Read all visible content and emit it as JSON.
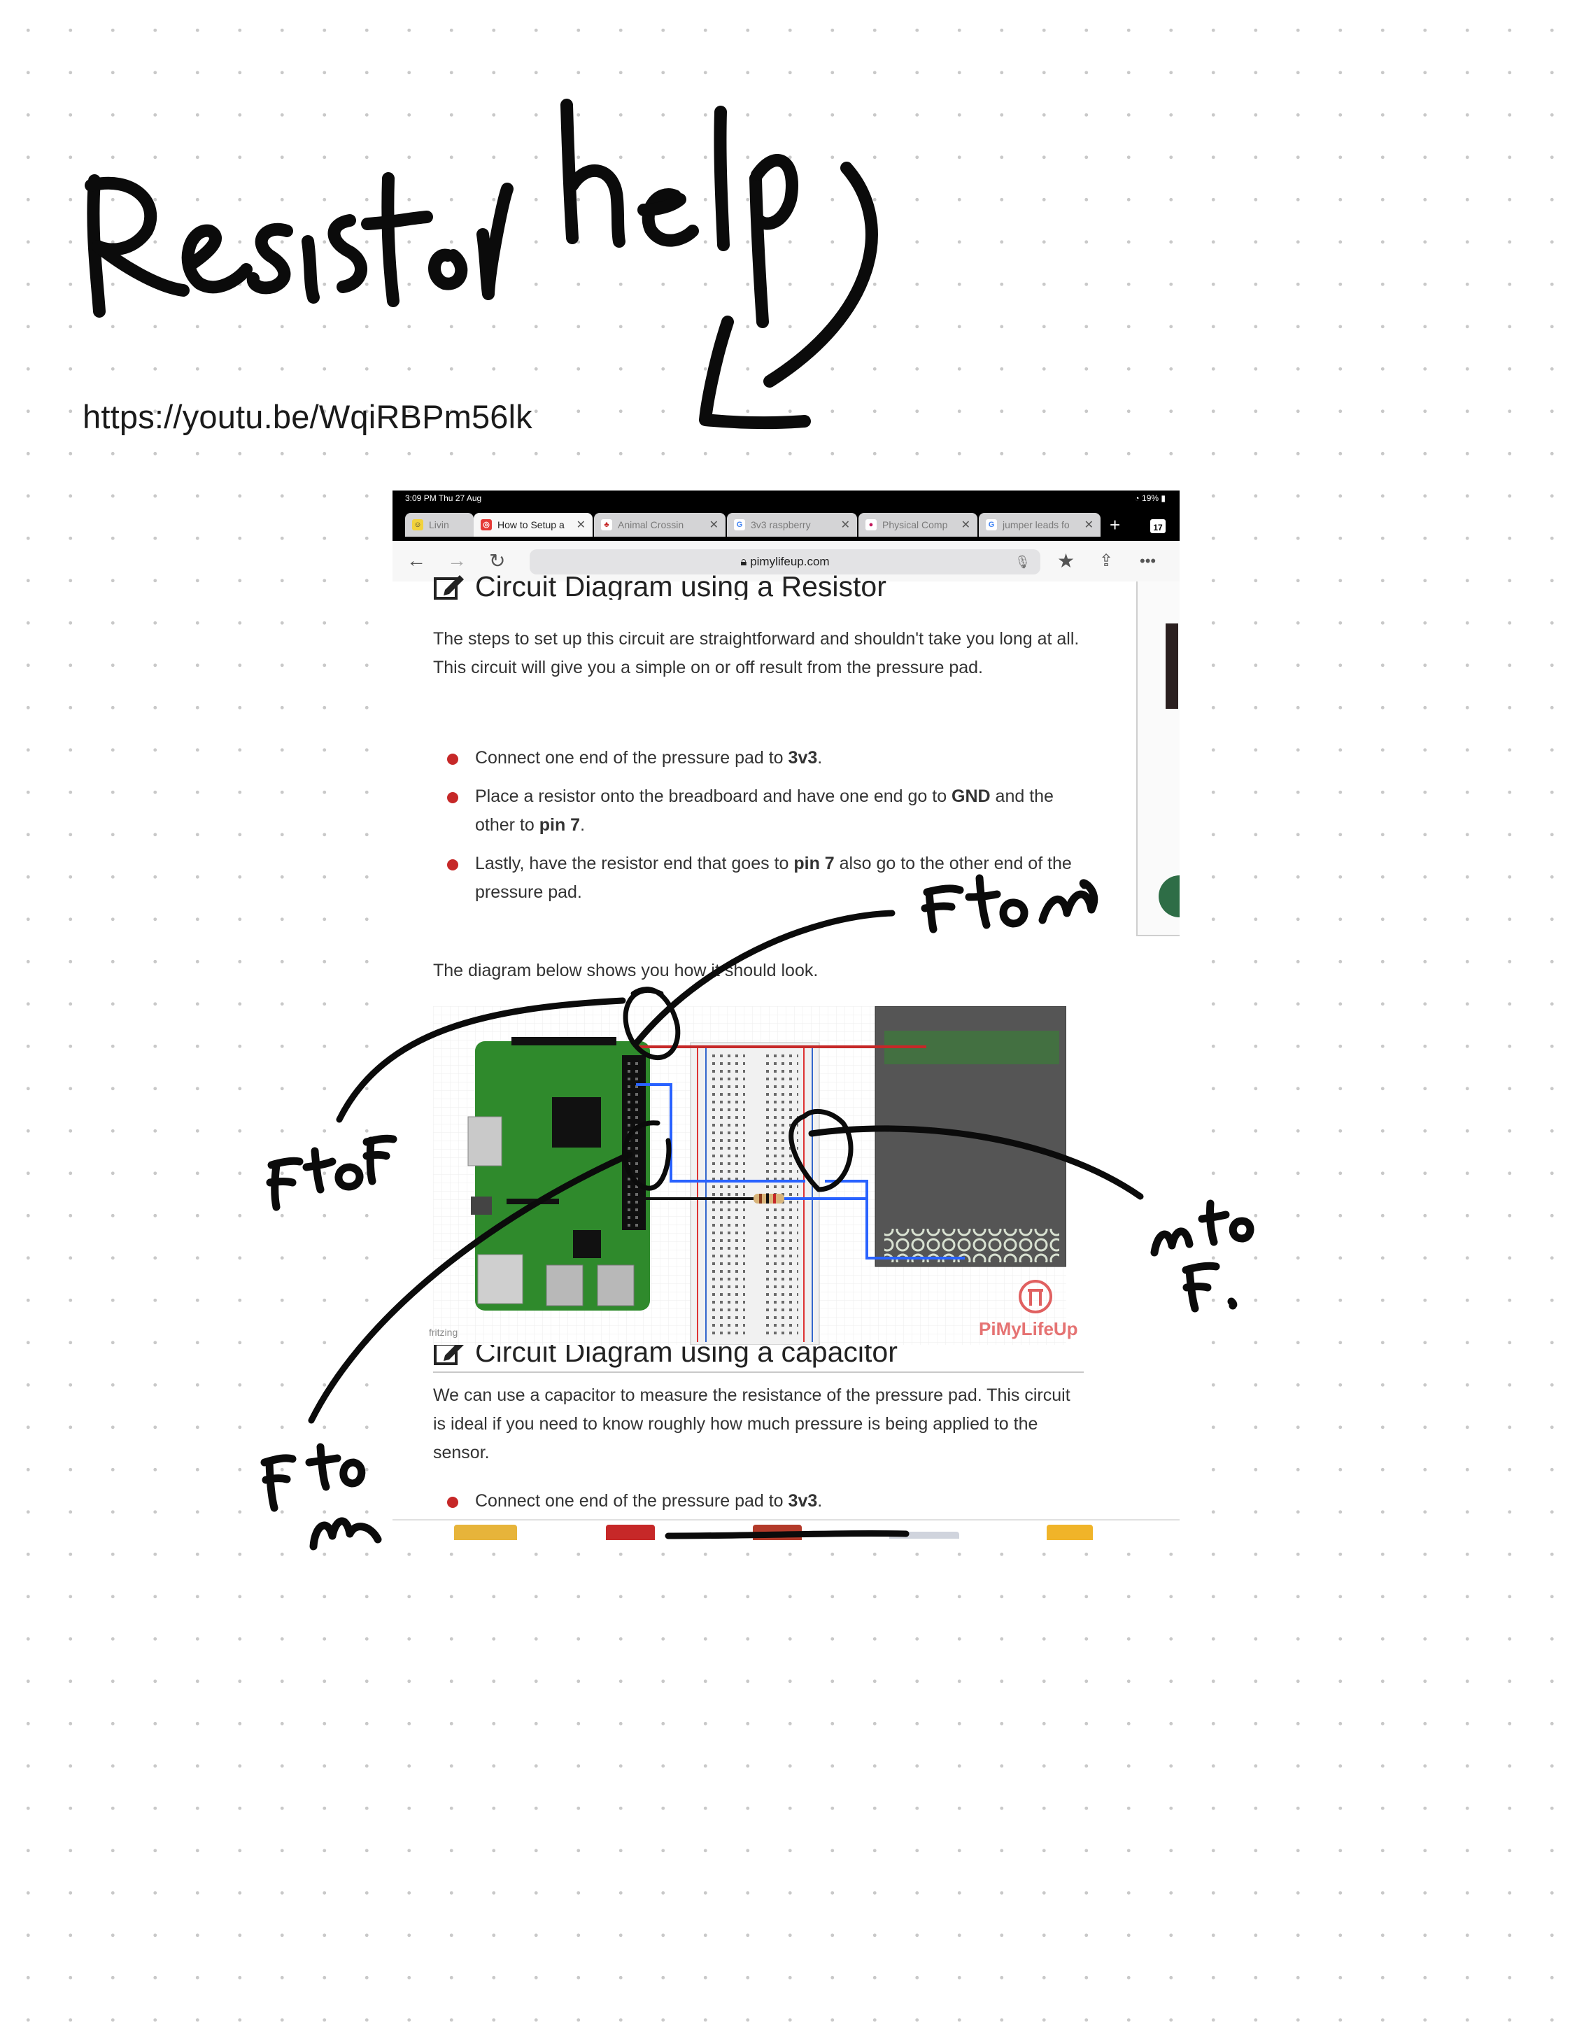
{
  "note": {
    "heading_handwritten": "Resistor help",
    "link_text": "https://youtu.be/WqiRBPm56lk",
    "annotations": [
      "F to m",
      "F to F",
      "m to F.",
      "F to m"
    ]
  },
  "screenshot": {
    "status": {
      "time": "3:09 PM   Thu 27 Aug",
      "battery": "19%"
    },
    "tabs": [
      {
        "label": "Livin",
        "icon": "smiley-favicon-icon"
      },
      {
        "label": "How to Setup a",
        "icon": "pimylifeup-favicon-icon"
      },
      {
        "label": "Animal Crossin",
        "icon": "leaf-favicon-icon"
      },
      {
        "label": "3v3 raspberry",
        "icon": "google-favicon-icon"
      },
      {
        "label": "Physical Comp",
        "icon": "raspberry-favicon-icon"
      },
      {
        "label": "jumper leads fo",
        "icon": "google-favicon-icon"
      }
    ],
    "tab_count": "17",
    "address": "pimylifeup.com",
    "article": {
      "section1_title": "Circuit Diagram using a Resistor",
      "section1_intro": "The steps to set up this circuit are straightforward and shouldn't take you long at all. This circuit will give you a simple on or off result from the pressure pad.",
      "bullet1": {
        "a": "Connect one end of the pressure pad to ",
        "b": "3v3",
        "c": "."
      },
      "bullet2": {
        "a": "Place a resistor onto the breadboard and have one end go to ",
        "b": "GND",
        "c": " and the other to ",
        "d": "pin 7",
        "e": "."
      },
      "bullet3": {
        "a": "Lastly, have the resistor end that goes to ",
        "b": "pin 7",
        "c": " also go to the other end of the pressure pad."
      },
      "diagram_caption": "The diagram below shows you how it should look.",
      "diagram_credit_left": "fritzing",
      "diagram_credit_right": "PiMyLifeUp",
      "section2_title": "Circuit Diagram using a capacitor",
      "section2_intro": "We can use a capacitor to measure the resistance of the pressure pad. This circuit is ideal if you need to know roughly how much pressure is being applied to the sensor.",
      "bullet4": {
        "a": "Connect one end of the pressure pad to ",
        "b": "3v3",
        "c": "."
      }
    }
  }
}
